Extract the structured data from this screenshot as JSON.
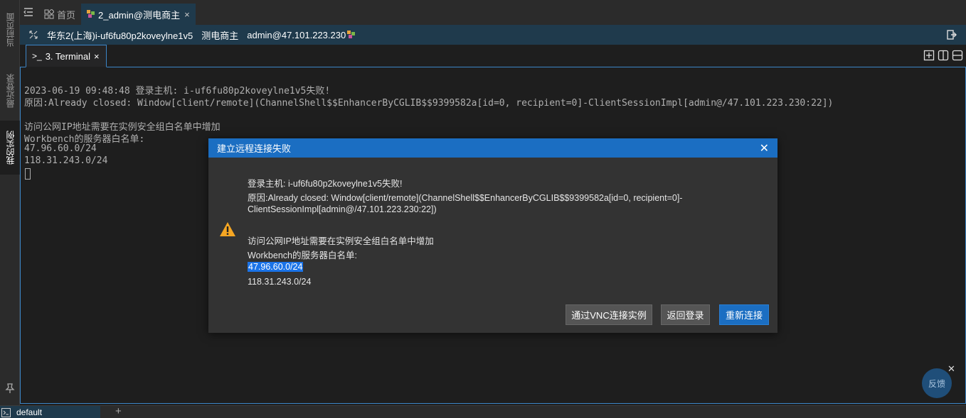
{
  "sidebar": {
    "items": [
      {
        "label": "当前页面",
        "icon": "clock-icon"
      },
      {
        "label": "最近登录",
        "icon": "info-icon"
      },
      {
        "label": "我的实例",
        "icon": "list-icon"
      }
    ]
  },
  "tabs": {
    "home_label": "首页",
    "session_label": "2_admin@测电商主",
    "close_glyph": "×"
  },
  "session": {
    "host": "华东2(上海)i-uf6fu80p2koveylne1v5",
    "instance_name": "测电商主",
    "user_host": "admin@47.101.223.230"
  },
  "terminal_tab": {
    "prompt_glyph": ">_",
    "label": "3. Terminal",
    "close_glyph": "×"
  },
  "terminal": {
    "lines": [
      "2023-06-19 09:48:48 登录主机: i-uf6fu80p2koveylne1v5失败!",
      "原因:Already closed: Window[client/remote](ChannelShell$$EnhancerByCGLIB$$9399582a[id=0, recipient=0]-ClientSessionImpl[admin@/47.101.223.230:22])",
      "",
      "访问公网IP地址需要在实例安全组白名单中增加",
      "Workbench的服务器白名单:",
      "47.96.60.0/24",
      "118.31.243.0/24"
    ]
  },
  "dialog": {
    "title": "建立远程连接失败",
    "close_glyph": "✕",
    "line1": "登录主机: i-uf6fu80p2koveylne1v5失败!",
    "line2": "原因:Already closed: Window[client/remote](ChannelShell$$EnhancerByCGLIB$$9399582a[id=0, recipient=0]-",
    "line3": "ClientSessionImpl[admin@/47.101.223.230:22])",
    "line4": "访问公网IP地址需要在实例安全组白名单中增加",
    "line5": "Workbench的服务器白名单:",
    "ip1": "47.96.60.0/24",
    "ip2": "118.31.243.0/24",
    "buttons": {
      "vnc": "通过VNC连接实例",
      "back": "返回登录",
      "reconnect": "重新连接"
    }
  },
  "feedback": {
    "label": "反馈",
    "close_glyph": "✕"
  },
  "statusbar": {
    "tab_label": "default",
    "add_glyph": "+"
  },
  "colors": {
    "accent": "#1b6ec2",
    "header_bar": "#1f3a4c",
    "warning": "#f5a623"
  }
}
